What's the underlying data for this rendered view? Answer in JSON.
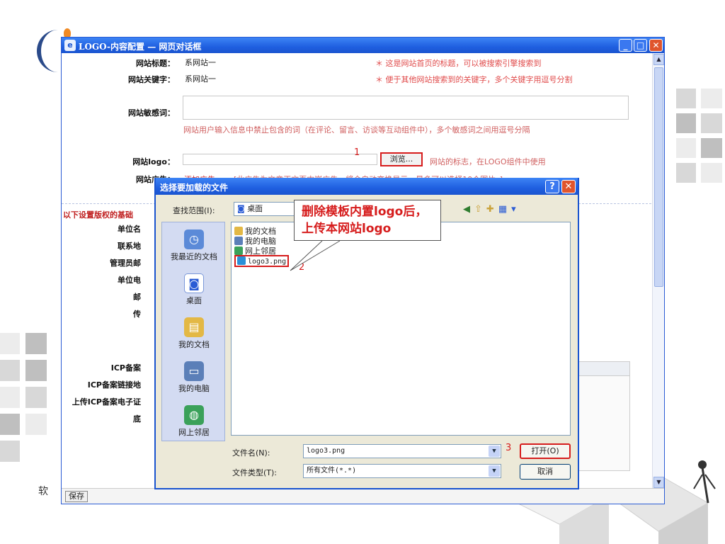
{
  "slide": {
    "footer_text": "软",
    "colors": {
      "accent": "#2a5bd4",
      "highlight": "#d61c1c"
    }
  },
  "window": {
    "title": "LOGO-内容配置 — 网页对话框",
    "icon": "ie-icon",
    "controls": [
      "minimize-icon",
      "maximize-icon",
      "close-icon"
    ]
  },
  "form": {
    "site_title": {
      "label": "网站标题：",
      "value": "系网站一",
      "hint": "＊ 这是网站首页的标题，可以被搜索引擎搜索到"
    },
    "site_keywords": {
      "label": "网站关键字：",
      "value": "系网站一",
      "hint": "＊ 便于其他网站搜索到的关键字，多个关键字用逗号分割"
    },
    "sensitive_words": {
      "label": "网站敏感词：",
      "value": "",
      "hint": "网站用户输入信息中禁止包含的词（在评论、留言、访谈等互动组件中），多个敏感词之间用逗号分隔"
    },
    "site_logo": {
      "label": "网站logo：",
      "value": "",
      "browse": "浏览...",
      "hint": "网站的标志，在LOGO组件中使用"
    },
    "site_ads": {
      "label": "网站广告：",
      "link": "添加广告",
      "hint": "[此广告为文章正文页内嵌广告，将会自动变换显示，最多可以选择10个图片。]"
    },
    "section_title": "以下设置版权的基础",
    "truncated_labels": [
      "单位名",
      "联系地",
      "管理员邮",
      "单位电",
      "邮",
      "传",
      "ICP备案",
      "ICP备案链接地",
      "上传ICP备案电子证",
      "底"
    ],
    "save_button": "保存"
  },
  "dialog": {
    "title": "选择要加载的文件",
    "look_in_label": "查找范围(I):",
    "look_in_value": "桌面",
    "places": [
      {
        "label": "我最近的文档",
        "icon": "recent-docs-icon"
      },
      {
        "label": "桌面",
        "icon": "desktop-icon"
      },
      {
        "label": "我的文档",
        "icon": "my-documents-icon"
      },
      {
        "label": "我的电脑",
        "icon": "my-computer-icon"
      },
      {
        "label": "网上邻居",
        "icon": "network-places-icon"
      }
    ],
    "files": [
      {
        "name": "我的文档",
        "icon": "folder-icon"
      },
      {
        "name": "我的电脑",
        "icon": "computer-icon"
      },
      {
        "name": "网上邻居",
        "icon": "network-icon"
      },
      {
        "name": "logo3.png",
        "icon": "image-file-icon"
      }
    ],
    "file_name_label": "文件名(N):",
    "file_name_value": "logo3.png",
    "file_type_label": "文件类型(T):",
    "file_type_value": "所有文件(*.*)",
    "open_button": "打开(O)",
    "cancel_button": "取消"
  },
  "annotations": {
    "callout_line1": "删除模板内置logo后，",
    "callout_line2": "上传本网站logo",
    "step1": "1",
    "step2": "2",
    "step3": "3"
  }
}
